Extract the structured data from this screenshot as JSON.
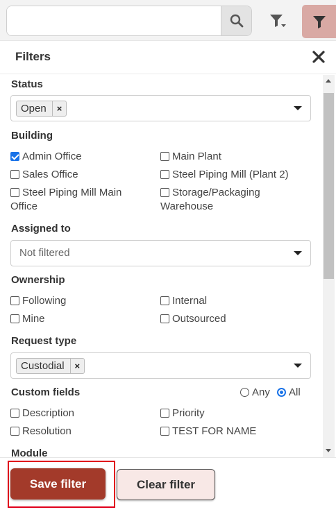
{
  "search": {
    "value": "",
    "placeholder": ""
  },
  "icons": {
    "search": "search-icon",
    "filter_menu": "filter-dropdown-icon",
    "filter_toggle": "filter-icon",
    "close": "close-icon"
  },
  "colors": {
    "accent": "#a33a2a",
    "filter_toggle_bg": "#d9a9a4",
    "checkbox_checked": "#1a73e8",
    "highlight": "#e0001b"
  },
  "panel": {
    "title": "Filters"
  },
  "sections": {
    "status": {
      "label": "Status",
      "tag": "Open",
      "tag_remove": "×"
    },
    "building": {
      "label": "Building",
      "options": [
        {
          "label": "Admin Office",
          "checked": true
        },
        {
          "label": "Main Plant",
          "checked": false
        },
        {
          "label": "Sales Office",
          "checked": false
        },
        {
          "label": "Steel Piping Mill (Plant 2)",
          "checked": false
        },
        {
          "label": "Steel Piping Mill Main Office",
          "checked": false
        },
        {
          "label": "Storage/Packaging Warehouse",
          "checked": false
        }
      ]
    },
    "assigned_to": {
      "label": "Assigned to",
      "placeholder": "Not filtered"
    },
    "ownership": {
      "label": "Ownership",
      "options": [
        {
          "label": "Following",
          "checked": false
        },
        {
          "label": "Internal",
          "checked": false
        },
        {
          "label": "Mine",
          "checked": false
        },
        {
          "label": "Outsourced",
          "checked": false
        }
      ]
    },
    "request_type": {
      "label": "Request type",
      "tag": "Custodial",
      "tag_remove": "×"
    },
    "custom_fields": {
      "label": "Custom fields",
      "match_any": "Any",
      "match_all": "All",
      "selected_match": "All",
      "options": [
        {
          "label": "Description",
          "checked": false
        },
        {
          "label": "Priority",
          "checked": false
        },
        {
          "label": "Resolution",
          "checked": false
        },
        {
          "label": "TEST FOR NAME",
          "checked": false
        }
      ]
    },
    "module": {
      "label": "Module"
    }
  },
  "footer": {
    "save_label": "Save filter",
    "clear_label": "Clear filter"
  }
}
